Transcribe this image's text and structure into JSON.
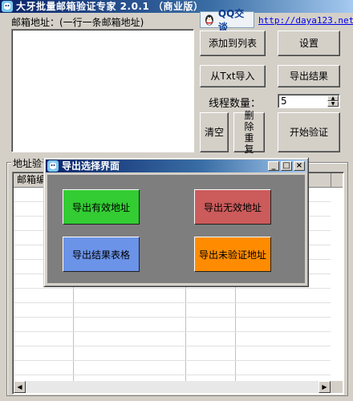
{
  "window": {
    "title": "大牙批量邮箱验证专家 2.0.1  （商业版）"
  },
  "header": {
    "email_label": "邮箱地址：(一行一条邮箱地址)",
    "qq_button": "QQ交谈",
    "website": "http://daya123.net"
  },
  "email_input": {
    "value": ""
  },
  "buttons": {
    "add_to_list": "添加到列表",
    "settings": "设置",
    "import_txt": "从Txt导入",
    "export_results": "导出结果",
    "clear": "清空",
    "delete_dup": "删除重复",
    "start_verify": "开始验证"
  },
  "threads": {
    "label": "线程数量：",
    "value": "5"
  },
  "groupbox": {
    "label": "地址验证"
  },
  "grid": {
    "columns": [
      "邮箱编",
      "",
      "",
      ""
    ]
  },
  "dialog": {
    "title": "导出选择界面",
    "buttons": {
      "valid": {
        "label": "导出有效地址",
        "color": "#33cc33"
      },
      "invalid": {
        "label": "导出无效地址",
        "color": "#cc5b5b"
      },
      "table": {
        "label": "导出结果表格",
        "color": "#6b93e8"
      },
      "unverified": {
        "label": "导出未验证地址",
        "color": "#ff8c00"
      }
    }
  },
  "icons": {
    "app": "penguin-icon",
    "qq": "qq-penguin-icon",
    "minimize": "minimize-icon",
    "maximize": "maximize-icon",
    "close": "close-icon"
  }
}
